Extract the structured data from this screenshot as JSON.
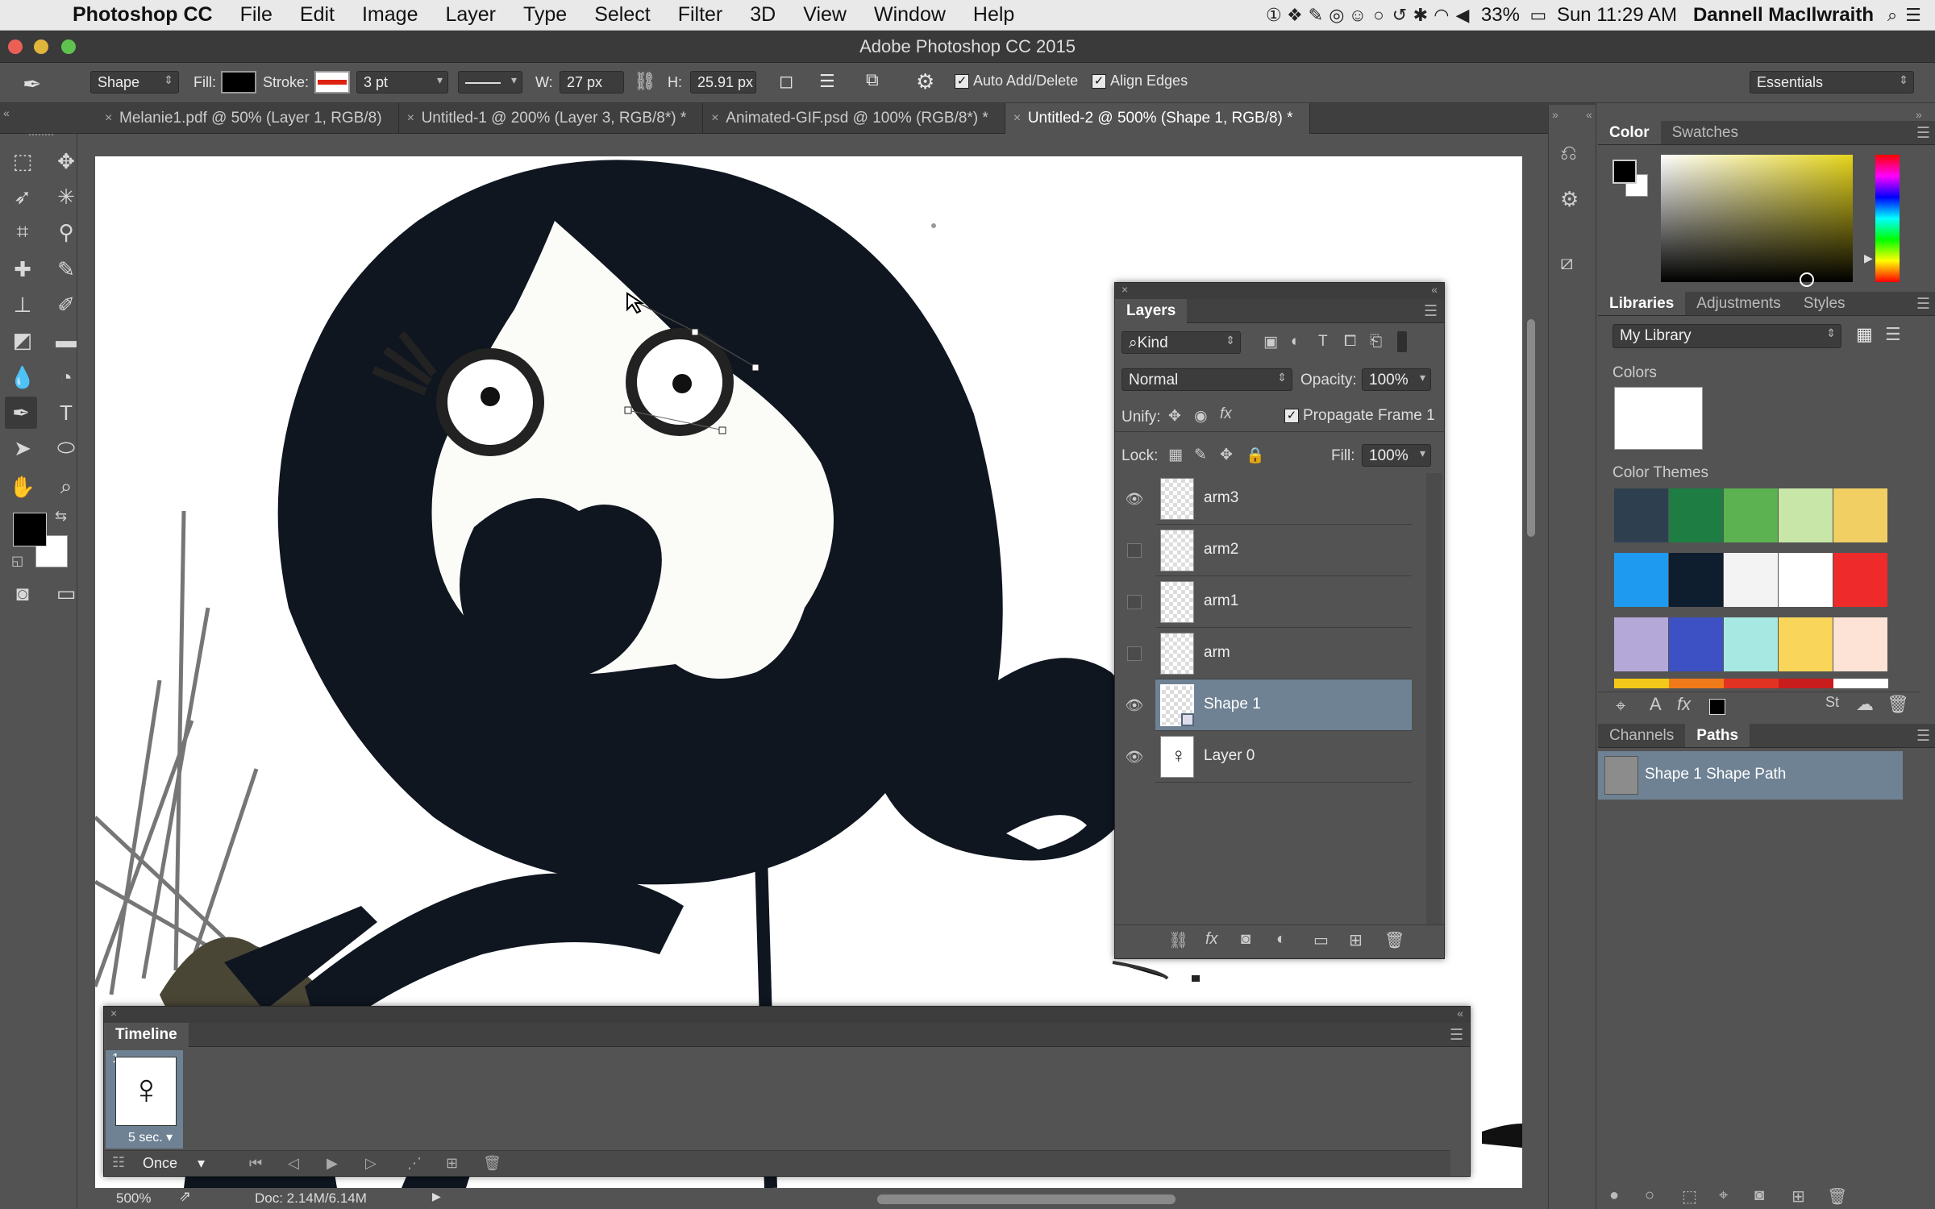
{
  "menubar": {
    "app_name": "Photoshop CC",
    "items": [
      "File",
      "Edit",
      "Image",
      "Layer",
      "Type",
      "Select",
      "Filter",
      "3D",
      "View",
      "Window",
      "Help"
    ],
    "battery": "33%",
    "clock": "Sun 11:29 AM",
    "user": "Dannell MacIlwraith"
  },
  "window": {
    "title": "Adobe Photoshop CC 2015"
  },
  "options": {
    "mode": "Shape",
    "fill_label": "Fill:",
    "stroke_label": "Stroke:",
    "stroke_width": "3 pt",
    "w_label": "W:",
    "w_value": "27 px",
    "h_label": "H:",
    "h_value": "25.91 px",
    "auto_add_delete": "Auto Add/Delete",
    "align_edges": "Align Edges",
    "workspace": "Essentials"
  },
  "tabs": [
    {
      "label": "Melanie1.pdf @ 50% (Layer 1, RGB/8)"
    },
    {
      "label": "Untitled-1 @ 200% (Layer 3, RGB/8*) *"
    },
    {
      "label": "Animated-GIF.psd @ 100% (RGB/8*) *"
    },
    {
      "label": "Untitled-2 @ 500% (Shape 1, RGB/8) *"
    }
  ],
  "status": {
    "zoom": "500%",
    "doc": "Doc: 2.14M/6.14M"
  },
  "layers": {
    "title": "Layers",
    "filter": "Kind",
    "blend_mode": "Normal",
    "opacity_label": "Opacity:",
    "opacity": "100%",
    "unify_label": "Unify:",
    "propagate": "Propagate Frame 1",
    "lock_label": "Lock:",
    "fill_label": "Fill:",
    "fill": "100%",
    "rows": [
      {
        "name": "arm3",
        "visible": true
      },
      {
        "name": "arm2",
        "visible": false
      },
      {
        "name": "arm1",
        "visible": false
      },
      {
        "name": "arm",
        "visible": false
      },
      {
        "name": "Shape 1",
        "visible": true
      },
      {
        "name": "Layer 0",
        "visible": true
      }
    ]
  },
  "timeline": {
    "title": "Timeline",
    "frame_number": "1",
    "frame_delay": "5 sec.",
    "loop": "Once"
  },
  "color_panel": {
    "tabs": [
      "Color",
      "Swatches"
    ]
  },
  "libraries": {
    "tabs": [
      "Libraries",
      "Adjustments",
      "Styles"
    ],
    "library": "My Library",
    "colors_label": "Colors",
    "themes_label": "Color Themes",
    "theme_colors": [
      [
        "#2e4050",
        "#1e7d43",
        "#5cb150",
        "#c8e6a8",
        "#f2cf63"
      ],
      [
        "#1e9bf0",
        "#0f1e2e",
        "#f3f3f3",
        "#ffffff",
        "#ee2a2a"
      ],
      [
        "#b3a8d8",
        "#3d51c4",
        "#a8e8e2",
        "#f9d55a",
        "#fde2d6"
      ]
    ]
  },
  "paths": {
    "tabs": [
      "Channels",
      "Paths"
    ],
    "items": [
      "Shape 1 Shape Path"
    ]
  }
}
